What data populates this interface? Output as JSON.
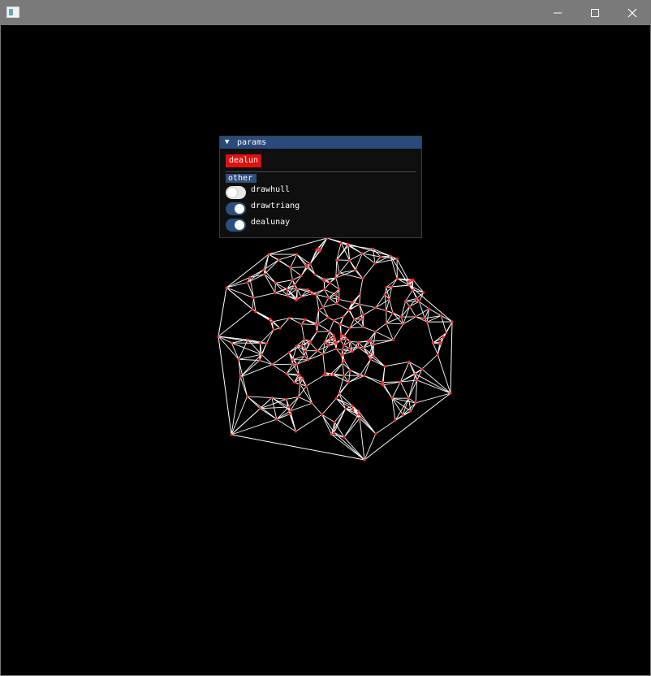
{
  "window": {
    "controls": {
      "minimize_icon": "minimize-icon",
      "maximize_icon": "maximize-icon",
      "close_icon": "close-icon"
    }
  },
  "panel": {
    "title": "params",
    "collapse_icon": "triangle-down-icon",
    "button_label": "dealun",
    "section_label": "other",
    "toggles": [
      {
        "label": "drawhull",
        "on": false
      },
      {
        "label": "drawtriang",
        "on": true
      },
      {
        "label": "dealunay",
        "on": true
      }
    ]
  },
  "colors": {
    "background": "#000000",
    "edges": "#ffffff",
    "points": "#ff2a2a",
    "accent": "#294a7a",
    "button": "#e0110f"
  }
}
